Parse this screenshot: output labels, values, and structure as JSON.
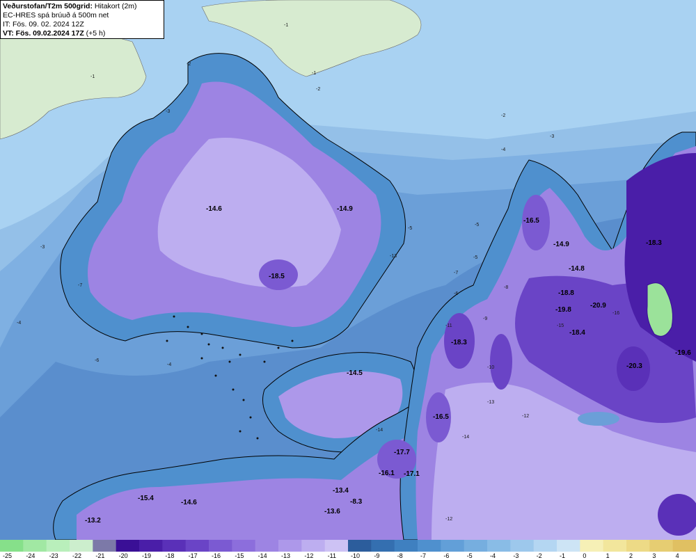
{
  "header": {
    "title": "Veðurstofan/T2m 500grid:",
    "title_suffix": "Hitakort (2m)",
    "model": "EC-HRES spá brúuð á 500m net",
    "init_time": "IT: Fös. 09. 02. 2024 12Z",
    "valid_time": "VT: Fös. 09.02.2024 17Z",
    "valid_suffix": "(+5 h)"
  },
  "legend": {
    "values": [
      "-25",
      "-24",
      "-23",
      "-22",
      "-21",
      "-20",
      "-19",
      "-18",
      "-17",
      "-16",
      "-15",
      "-14",
      "-13",
      "-12",
      "-11",
      "-10",
      "-9",
      "-8",
      "-7",
      "-6",
      "-5",
      "-4",
      "-3",
      "-2",
      "-1",
      "0",
      "1",
      "2",
      "3",
      "4"
    ],
    "colors": [
      "#86e08a",
      "#a1e8a3",
      "#b9efbb",
      "#cceecd",
      "#7c79a8",
      "#3a0f96",
      "#4a1ea8",
      "#5a30b8",
      "#6a44c6",
      "#7b5ad2",
      "#8c6edc",
      "#9d84e3",
      "#ad98ea",
      "#bdaef0",
      "#cdc2f4",
      "#2c5d9c",
      "#346fb0",
      "#3f80c0",
      "#4f90ce",
      "#629fd8",
      "#76aedf",
      "#89bce6",
      "#9dc8ec",
      "#b4d6f2",
      "#cde4f5",
      "#f6f0b6",
      "#f2e69c",
      "#edda86",
      "#e6cd72",
      "#e0c062"
    ]
  },
  "map": {
    "colors": {
      "sea": "#a9d2f2",
      "greenland": "#d7ebd0",
      "coast": "#000000"
    },
    "labels": [
      {
        "text": "-14.6"
      },
      {
        "text": "-14.9"
      },
      {
        "text": "-18.5"
      },
      {
        "text": "-16.5"
      },
      {
        "text": "-14.9"
      },
      {
        "text": "-14.8"
      },
      {
        "text": "-18.3"
      },
      {
        "text": "-18.8"
      },
      {
        "text": "-19.8"
      },
      {
        "text": "-20.9"
      },
      {
        "text": "-18.4"
      },
      {
        "text": "-18.3"
      },
      {
        "text": "-14.5"
      },
      {
        "text": "-20.3"
      },
      {
        "text": "-19.6"
      },
      {
        "text": "-16.5"
      },
      {
        "text": "-17.7"
      },
      {
        "text": "-16.1"
      },
      {
        "text": "-17.1"
      },
      {
        "text": "-15.4"
      },
      {
        "text": "-14.6"
      },
      {
        "text": "-13.4"
      },
      {
        "text": "-8.3"
      },
      {
        "text": "-13.6"
      },
      {
        "text": "-13.2"
      }
    ],
    "contour_labels": [
      "-1",
      "-1",
      "-1",
      "-2",
      "-2",
      "-2",
      "-3",
      "-3",
      "-3",
      "-4",
      "-4",
      "-4",
      "-5",
      "-5",
      "-5",
      "-6",
      "-6",
      "-7",
      "-7",
      "-8",
      "-9",
      "-10",
      "-11",
      "-12",
      "-12",
      "-13",
      "-13",
      "-14",
      "-14",
      "-15",
      "-16"
    ]
  }
}
